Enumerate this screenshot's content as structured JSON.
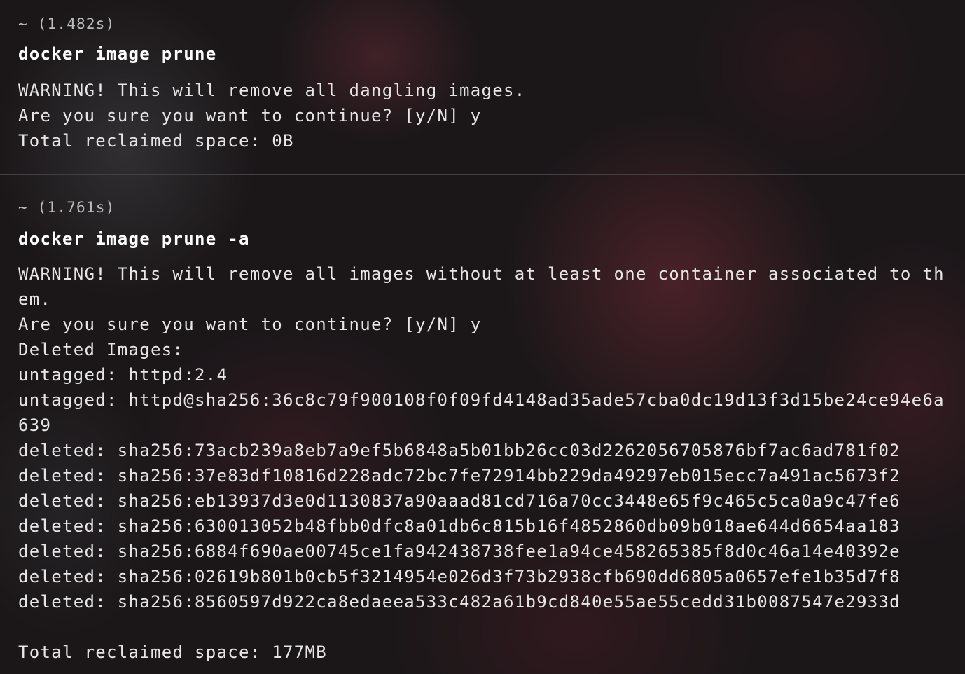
{
  "blocks": [
    {
      "prompt": "~ (1.482s)",
      "command": "docker image prune",
      "output": [
        "WARNING! This will remove all dangling images.",
        "Are you sure you want to continue? [y/N] y",
        "Total reclaimed space: 0B"
      ]
    },
    {
      "prompt": "~ (1.761s)",
      "command": "docker image prune -a",
      "output": [
        "WARNING! This will remove all images without at least one container associated to th",
        "em.",
        "Are you sure you want to continue? [y/N] y",
        "Deleted Images:",
        "untagged: httpd:2.4",
        "untagged: httpd@sha256:36c8c79f900108f0f09fd4148ad35ade57cba0dc19d13f3d15be24ce94e6a",
        "639",
        "deleted: sha256:73acb239a8eb7a9ef5b6848a5b01bb26cc03d2262056705876bf7ac6ad781f02",
        "deleted: sha256:37e83df10816d228adc72bc7fe72914bb229da49297eb015ecc7a491ac5673f2",
        "deleted: sha256:eb13937d3e0d1130837a90aaad81cd716a70cc3448e65f9c465c5ca0a9c47fe6",
        "deleted: sha256:630013052b48fbb0dfc8a01db6c815b16f4852860db09b018ae644d6654aa183",
        "deleted: sha256:6884f690ae00745ce1fa942438738fee1a94ce458265385f8d0c46a14e40392e",
        "deleted: sha256:02619b801b0cb5f3214954e026d3f73b2938cfb690dd6805a0657efe1b35d7f8",
        "deleted: sha256:8560597d922ca8edaeea533c482a61b9cd840e55ae55cedd31b0087547e2933d",
        "",
        "Total reclaimed space: 177MB"
      ]
    }
  ]
}
